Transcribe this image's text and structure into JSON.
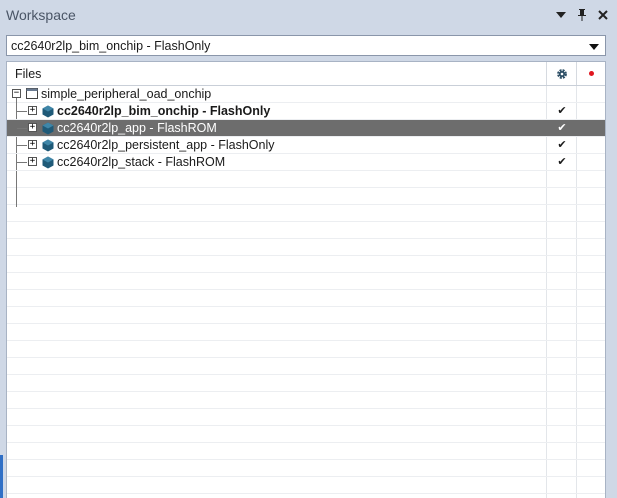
{
  "window": {
    "title": "Workspace"
  },
  "config_selector": {
    "value": "cc2640r2lp_bim_onchip - FlashOnly"
  },
  "header": {
    "files_label": "Files"
  },
  "tree": {
    "workspace": "simple_peripheral_oad_onchip",
    "projects": [
      {
        "name": "cc2640r2lp_bim_onchip - FlashOnly",
        "checked": true,
        "bold": true,
        "selected": false
      },
      {
        "name": "cc2640r2lp_app - FlashROM",
        "checked": true,
        "bold": false,
        "selected": true
      },
      {
        "name": "cc2640r2lp_persistent_app - FlashOnly",
        "checked": true,
        "bold": false,
        "selected": false
      },
      {
        "name": "cc2640r2lp_stack - FlashROM",
        "checked": true,
        "bold": false,
        "selected": false
      }
    ]
  },
  "icons": {
    "dropdown": "chevron-down-icon",
    "pin": "pin-icon",
    "close": "close-icon",
    "settings": "gear-icon",
    "breakpoint": "red-dot-icon",
    "project": "hexagon-project-icon",
    "workspace": "workspace-window-icon"
  },
  "colors": {
    "selection": "#6d6d6d",
    "accent": "#2f6fc6",
    "titlebar": "#cfd8e6"
  },
  "check_glyph": "✔"
}
